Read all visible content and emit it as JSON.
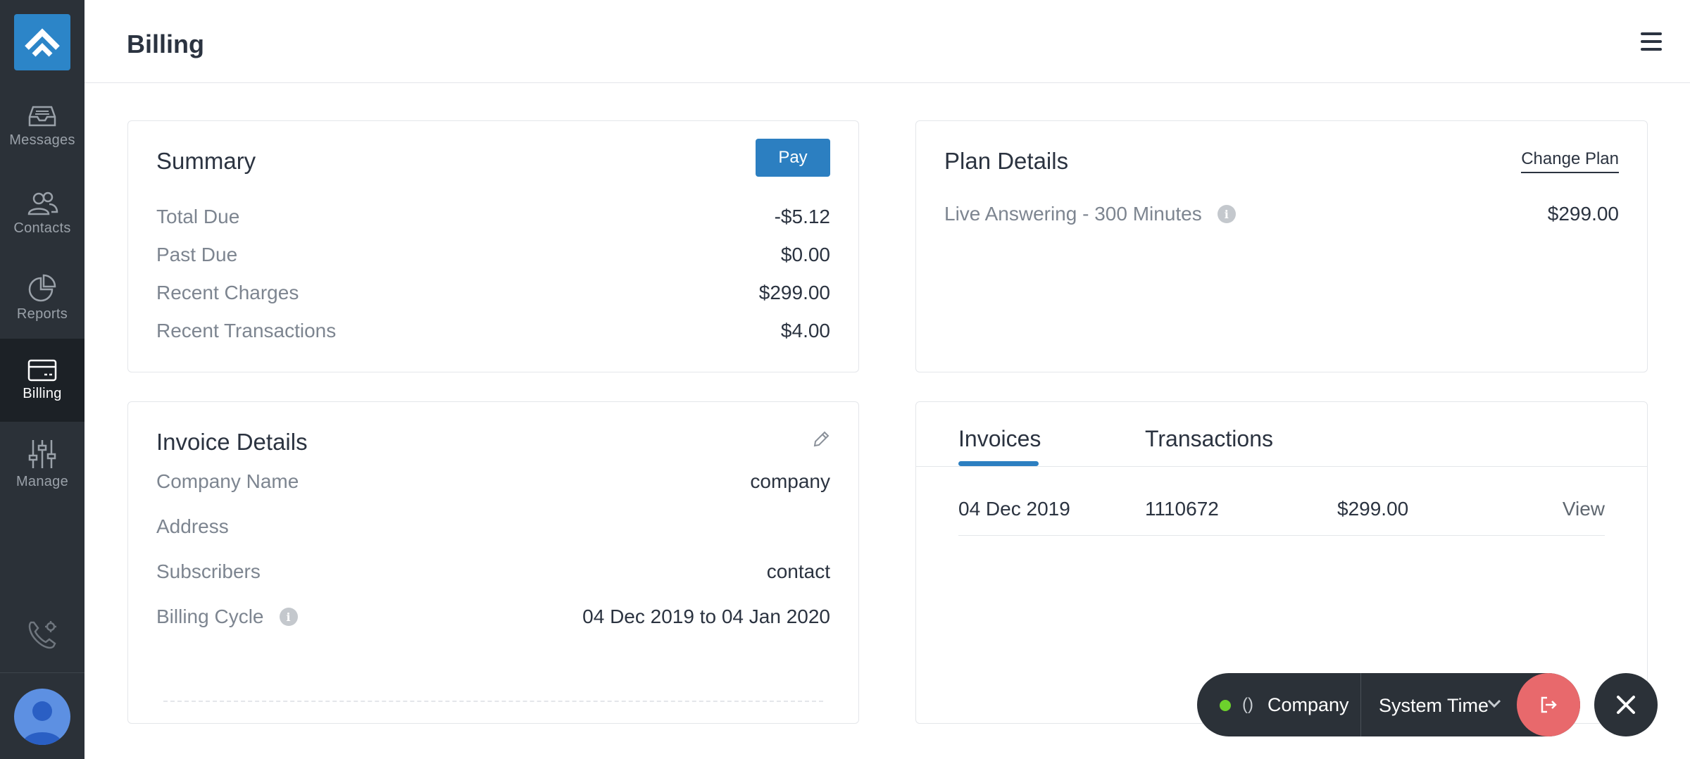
{
  "sidebar": {
    "items": [
      {
        "label": "Messages",
        "icon": "inbox-icon"
      },
      {
        "label": "Contacts",
        "icon": "contacts-icon"
      },
      {
        "label": "Reports",
        "icon": "pie-chart-icon"
      },
      {
        "label": "Billing",
        "icon": "credit-card-icon",
        "active": true
      },
      {
        "label": "Manage",
        "icon": "sliders-icon"
      }
    ]
  },
  "header": {
    "title": "Billing"
  },
  "summary": {
    "title": "Summary",
    "pay_label": "Pay",
    "rows": [
      {
        "label": "Total Due",
        "value": "-$5.12"
      },
      {
        "label": "Past Due",
        "value": "$0.00"
      },
      {
        "label": "Recent Charges",
        "value": "$299.00"
      },
      {
        "label": "Recent Transactions",
        "value": "$4.00"
      }
    ]
  },
  "plan": {
    "title": "Plan Details",
    "change_label": "Change Plan",
    "name": "Live Answering - 300 Minutes",
    "price": "$299.00"
  },
  "invoice_details": {
    "title": "Invoice Details",
    "rows": [
      {
        "label": "Company Name",
        "value": "company"
      },
      {
        "label": "Address",
        "value": ""
      },
      {
        "label": "Subscribers",
        "value": "contact"
      },
      {
        "label": "Billing Cycle",
        "value": "04 Dec 2019 to 04 Jan 2020"
      }
    ]
  },
  "invoices": {
    "tabs": [
      "Invoices",
      "Transactions"
    ],
    "active_tab": "Invoices",
    "rows": [
      {
        "date": "04 Dec 2019",
        "number": "1110672",
        "amount": "$299.00",
        "action": "View"
      }
    ]
  },
  "widget": {
    "status_color": "#6dd12c",
    "paren": "()",
    "company": "Company",
    "time_label": "System Time"
  },
  "colors": {
    "accent": "#2c7fc1",
    "sidebar": "#2b3138",
    "logout": "#e8696c"
  }
}
